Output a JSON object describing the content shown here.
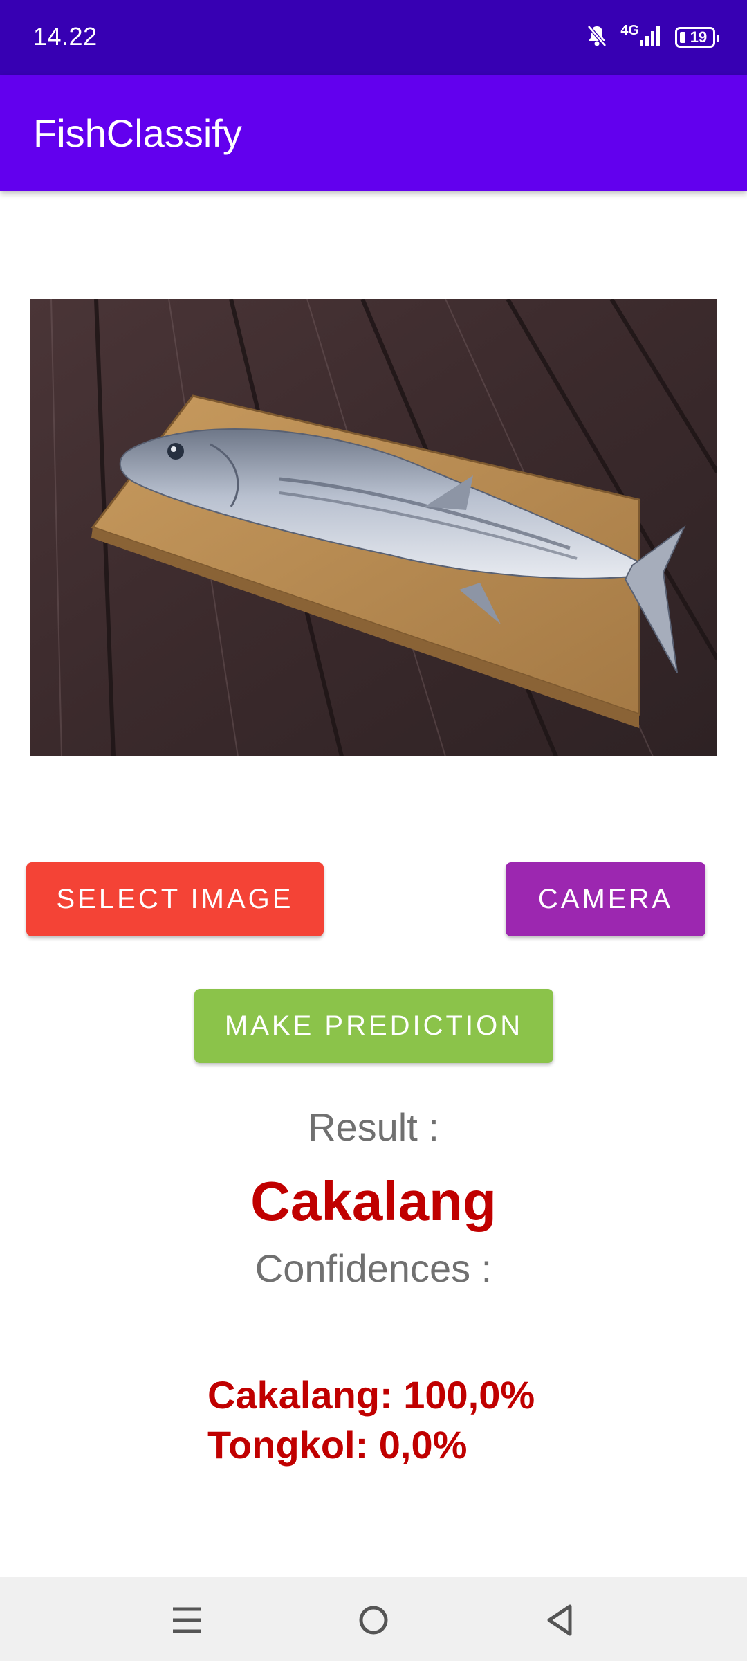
{
  "status_bar": {
    "time": "14.22",
    "network": "4G",
    "battery": "19"
  },
  "app_bar": {
    "title": "FishClassify"
  },
  "preview": {
    "description_icon": "fish-photo"
  },
  "buttons": {
    "select_image": "SELECT IMAGE",
    "camera": "CAMERA",
    "make_prediction": "MAKE PREDICTION"
  },
  "result": {
    "label": "Result :",
    "value": "Cakalang",
    "confidences_label": "Confidences :",
    "confidences": [
      "Cakalang: 100,0%",
      "Tongkol: 0,0%"
    ]
  },
  "colors": {
    "status_bar": "#3700b3",
    "app_bar": "#6200ee",
    "select_button": "#f44336",
    "camera_button": "#9c27b0",
    "predict_button": "#8bc34a",
    "result_text": "#c00000"
  }
}
